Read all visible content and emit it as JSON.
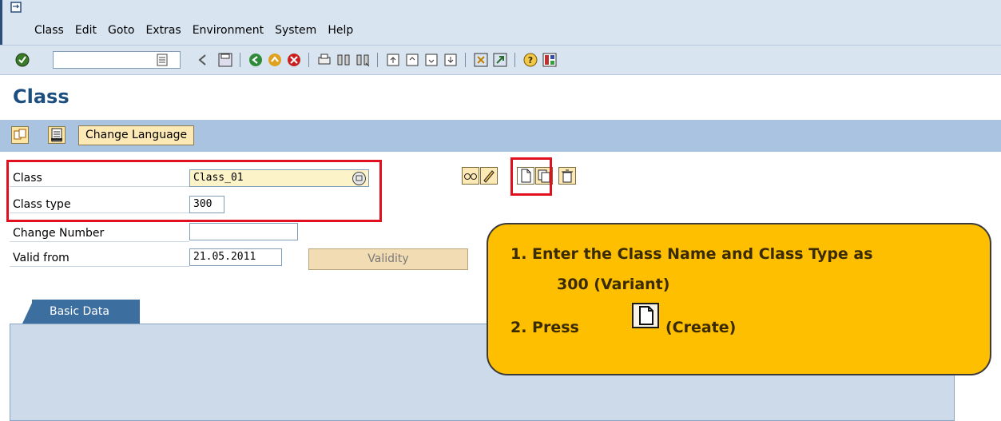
{
  "menu": {
    "items": [
      "Class",
      "Edit",
      "Goto",
      "Extras",
      "Environment",
      "System",
      "Help"
    ]
  },
  "toolbar": {
    "command_field_value": ""
  },
  "title": "Class",
  "app_toolbar": {
    "change_language_label": "Change Language"
  },
  "form": {
    "class_label": "Class",
    "class_value": "Class_01",
    "class_type_label": "Class type",
    "class_type_value": "300",
    "change_number_label": "Change Number",
    "change_number_value": "",
    "valid_from_label": "Valid from",
    "valid_from_value": "21.05.2011",
    "validity_button": "Validity"
  },
  "tabs": {
    "basic_data": "Basic Data"
  },
  "callout": {
    "line1": "1.  Enter the Class Name and Class Type as",
    "line2": "300 (Variant)",
    "line3_prefix": "2. Press",
    "line3_suffix": "(Create)"
  },
  "colors": {
    "title_blue": "#1c4e80",
    "highlight_red": "#e01020",
    "callout_yellow": "#fdbf00",
    "app_toolbar_blue": "#a9c3e1"
  }
}
